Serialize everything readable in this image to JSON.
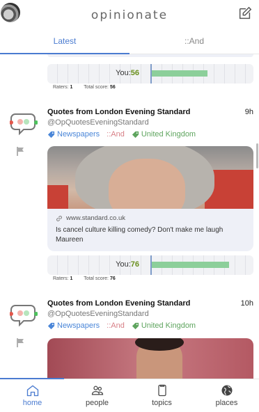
{
  "header": {
    "brand": "opinionate",
    "avatar": "user-avatar",
    "compose_icon": "compose-icon"
  },
  "tabs": [
    {
      "label": "Latest",
      "active": true
    },
    {
      "label": "::And",
      "active": false
    }
  ],
  "previous_post": {
    "score": {
      "you_label": "You:",
      "you_value": "56",
      "you_fraction": 0.55
    },
    "stats": {
      "raters_label": "Raters:",
      "raters": "1",
      "total_label": "Total score:",
      "total": "56"
    }
  },
  "posts": [
    {
      "title": "Quotes from London Evening Standard",
      "time": "9h",
      "handle": "@OpQuotesEveningStandard",
      "tags": [
        {
          "label": "Newspapers",
          "color": "#4a86d8",
          "icon": "tag-icon"
        },
        {
          "label": "::And",
          "color": "#d77f86",
          "icon": ""
        },
        {
          "label": "United Kingdom",
          "color": "#5ea45e",
          "icon": "tag-icon"
        }
      ],
      "link": {
        "domain": "www.standard.co.uk",
        "text": "Is cancel culture killing comedy? Don't make me laugh Maureen"
      },
      "score": {
        "you_label": "You:",
        "you_value": "76",
        "you_fraction": 0.76
      },
      "stats": {
        "raters_label": "Raters:",
        "raters": "1",
        "total_label": "Total score:",
        "total": "76"
      }
    },
    {
      "title": "Quotes from London Evening Standard",
      "time": "10h",
      "handle": "@OpQuotesEveningStandard",
      "tags": [
        {
          "label": "Newspapers",
          "color": "#4a86d8",
          "icon": "tag-icon"
        },
        {
          "label": "::And",
          "color": "#d77f86",
          "icon": ""
        },
        {
          "label": "United Kingdom",
          "color": "#5ea45e",
          "icon": "tag-icon"
        }
      ]
    }
  ],
  "bottom_nav": [
    {
      "label": "home",
      "icon": "home-icon",
      "active": true
    },
    {
      "label": "people",
      "icon": "people-icon",
      "active": false
    },
    {
      "label": "topics",
      "icon": "topics-icon",
      "active": false
    },
    {
      "label": "places",
      "icon": "globe-icon",
      "active": false
    }
  ],
  "colors": {
    "accent": "#4a7bd0",
    "score_bar": "#8ccf9a",
    "score_value": "#6a8f1e"
  }
}
